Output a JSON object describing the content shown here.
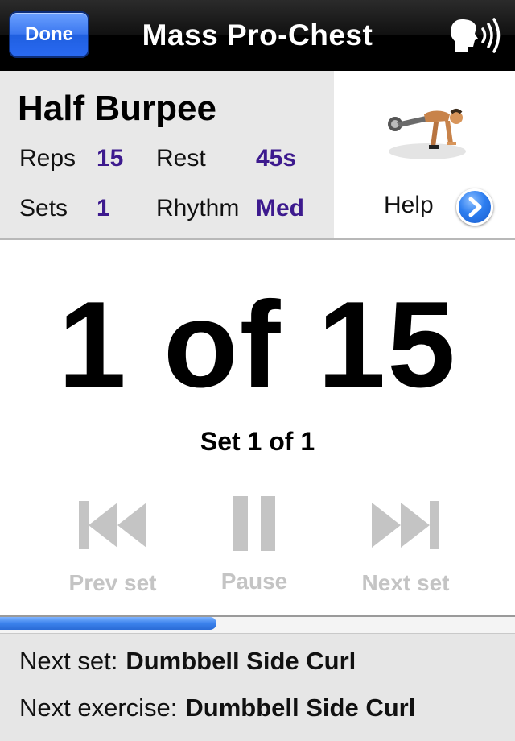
{
  "navbar": {
    "done_label": "Done",
    "title": "Mass Pro-Chest",
    "voice_icon": "speaking-head-icon"
  },
  "exercise": {
    "name": "Half Burpee",
    "reps_label": "Reps",
    "reps_value": "15",
    "rest_label": "Rest",
    "rest_value": "45s",
    "sets_label": "Sets",
    "sets_value": "1",
    "rhythm_label": "Rhythm",
    "rhythm_value": "Med",
    "help_label": "Help",
    "help_icon": "chevron-right-circle-icon",
    "value_color": "#3d1a8e"
  },
  "counter": {
    "rep_text": "1 of 15",
    "set_text": "Set 1 of 1"
  },
  "controls": {
    "prev_label": "Prev set",
    "pause_label": "Pause",
    "next_label": "Next set",
    "disabled_color": "#c4c4c4"
  },
  "progress": {
    "fraction": 0.42,
    "color": "#3b82ec"
  },
  "footer": {
    "next_set_label": "Next set:",
    "next_set_value": "Dumbbell Side Curl",
    "next_exercise_label": "Next exercise:",
    "next_exercise_value": "Dumbbell Side Curl"
  }
}
